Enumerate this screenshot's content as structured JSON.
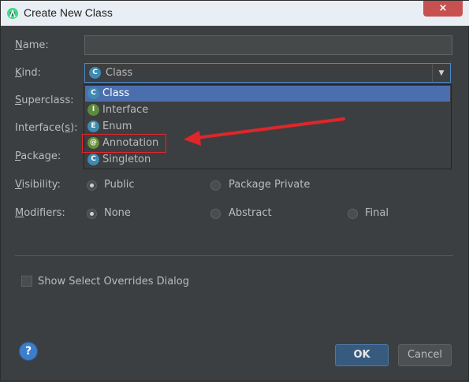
{
  "window": {
    "title": "Create New Class",
    "close_label": "×"
  },
  "form": {
    "name_label": "Name:",
    "name_value": "",
    "kind_label": "Kind:",
    "kind_value": "Class",
    "superclass_label": "Superclass:",
    "interfaces_label": "Interface(s):",
    "package_label": "Package:",
    "visibility_label": "Visibility:",
    "modifiers_label": "Modifiers:"
  },
  "kind_dropdown": {
    "items": [
      {
        "label": "Class",
        "icon": "class-icon",
        "glyph": "C",
        "selected": true
      },
      {
        "label": "Interface",
        "icon": "interface-icon",
        "glyph": "I",
        "selected": false
      },
      {
        "label": "Enum",
        "icon": "enum-icon",
        "glyph": "E",
        "selected": false
      },
      {
        "label": "Annotation",
        "icon": "annotation-icon",
        "glyph": "@",
        "selected": false
      },
      {
        "label": "Singleton",
        "icon": "singleton-icon",
        "glyph": "C",
        "selected": false
      }
    ],
    "highlighted_item": "Annotation",
    "annotation_color": "#e0262b"
  },
  "visibility": {
    "options": [
      {
        "label": "Public",
        "checked": true
      },
      {
        "label": "Package Private",
        "checked": false
      }
    ]
  },
  "modifiers": {
    "options": [
      {
        "label": "None",
        "checked": true
      },
      {
        "label": "Abstract",
        "checked": false
      },
      {
        "label": "Final",
        "checked": false
      }
    ]
  },
  "overrides": {
    "label": "Show Select Overrides Dialog",
    "checked": false
  },
  "footer": {
    "help_glyph": "?",
    "ok_label": "OK",
    "cancel_label": "Cancel"
  },
  "colors": {
    "background": "#3c3f41",
    "selection": "#4b6eaf",
    "accent_border": "#4a88c7"
  }
}
